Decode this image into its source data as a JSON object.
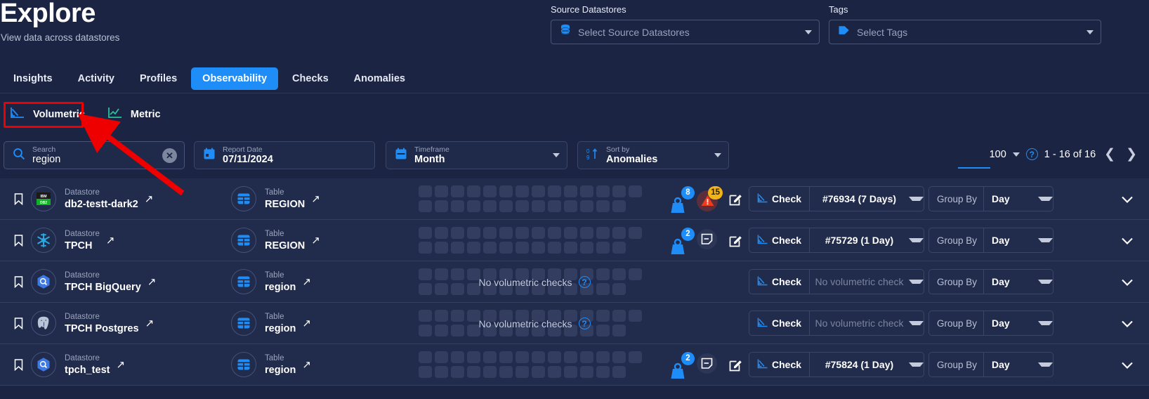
{
  "header": {
    "title": "Explore",
    "subtitle": "View data across datastores",
    "source_datastores": {
      "label": "Source Datastores",
      "placeholder": "Select Source Datastores",
      "icon": "database-icon"
    },
    "tags": {
      "label": "Tags",
      "placeholder": "Select Tags",
      "icon": "tag-icon"
    }
  },
  "tabs": [
    {
      "label": "Insights",
      "active": false
    },
    {
      "label": "Activity",
      "active": false
    },
    {
      "label": "Profiles",
      "active": false
    },
    {
      "label": "Observability",
      "active": true
    },
    {
      "label": "Checks",
      "active": false
    },
    {
      "label": "Anomalies",
      "active": false
    }
  ],
  "subtabs": [
    {
      "label": "Volumetric",
      "icon": "volumetric-chart-icon",
      "active": true
    },
    {
      "label": "Metric",
      "icon": "metric-chart-icon",
      "active": false
    }
  ],
  "annotation": {
    "color": "#ef0000",
    "target": "Volumetric"
  },
  "filters": {
    "search": {
      "label": "Search",
      "value": "region",
      "icon": "search-icon",
      "clear_icon": "clear-icon"
    },
    "report_date": {
      "label": "Report Date",
      "value": "07/11/2024",
      "icon": "calendar-icon"
    },
    "timeframe": {
      "label": "Timeframe",
      "value": "Month",
      "icon": "calendar-icon"
    },
    "sort_by": {
      "label": "Sort by",
      "value": "Anomalies",
      "icon": "sort-icon"
    }
  },
  "pagination": {
    "page_size": "100",
    "range": "1 - 16 of 16",
    "help_icon": "help-icon",
    "prev_icon": "chevron-left-icon",
    "next_icon": "chevron-right-icon"
  },
  "columns": {
    "datastore_label": "Datastore",
    "table_label": "Table",
    "check_label": "Check",
    "group_by_label": "Group By"
  },
  "no_checks_text": "No volumetric checks",
  "rows": [
    {
      "datastore": "db2-testt-dark2",
      "datastore_icon": "db2-icon",
      "table": "REGION",
      "has_checks": true,
      "weight_badge": "8",
      "alert_badge": "15",
      "alert_type": "warning",
      "check_value": "#76934 (7 Days)",
      "group_by_value": "Day"
    },
    {
      "datastore": "TPCH",
      "datastore_icon": "snowflake-icon",
      "table": "REGION",
      "has_checks": true,
      "weight_badge": "2",
      "alert_badge": null,
      "alert_type": "note",
      "check_value": "#75729 (1 Day)",
      "group_by_value": "Day"
    },
    {
      "datastore": "TPCH BigQuery",
      "datastore_icon": "bigquery-icon",
      "table": "region",
      "has_checks": false,
      "weight_badge": null,
      "alert_badge": null,
      "alert_type": null,
      "check_value": "No volumetric check",
      "group_by_value": "Day"
    },
    {
      "datastore": "TPCH Postgres",
      "datastore_icon": "postgres-icon",
      "table": "region",
      "has_checks": false,
      "weight_badge": null,
      "alert_badge": null,
      "alert_type": null,
      "check_value": "No volumetric check",
      "group_by_value": "Day"
    },
    {
      "datastore": "tpch_test",
      "datastore_icon": "bigquery-icon",
      "table": "region",
      "has_checks": true,
      "weight_badge": "2",
      "alert_badge": null,
      "alert_type": "note",
      "check_value": "#75824 (1 Day)",
      "group_by_value": "Day"
    }
  ],
  "colors": {
    "accent": "#1f8df8",
    "background": "#1b2442",
    "row_background": "#212b4b",
    "warning": "#f2b318",
    "danger": "#ef0000"
  }
}
